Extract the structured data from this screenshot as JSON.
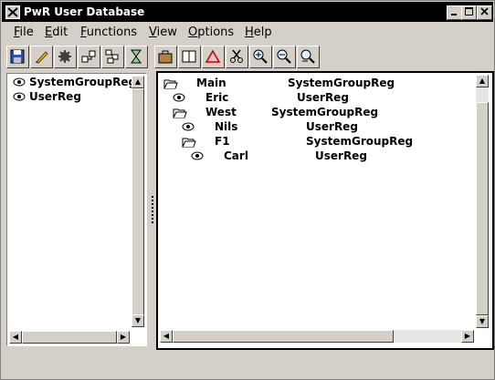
{
  "window": {
    "title": "PwR User Database"
  },
  "menubar": [
    {
      "first": "F",
      "rest": "ile"
    },
    {
      "first": "E",
      "rest": "dit"
    },
    {
      "first": "F",
      "rest": "unctions"
    },
    {
      "first": "V",
      "rest": "iew"
    },
    {
      "first": "O",
      "rest": "ptions"
    },
    {
      "first": "H",
      "rest": "elp"
    }
  ],
  "toolbar": [
    {
      "icon": "save-icon"
    },
    {
      "icon": "pencil-icon"
    },
    {
      "icon": "gear-icon"
    },
    {
      "icon": "hierarchy-icon"
    },
    {
      "icon": "tree-icon"
    },
    {
      "icon": "hourglass-icon"
    },
    {
      "icon": "briefcase-icon"
    },
    {
      "icon": "book-icon"
    },
    {
      "icon": "triangle-icon"
    },
    {
      "icon": "scissors-icon"
    },
    {
      "icon": "zoom-in-icon"
    },
    {
      "icon": "zoom-out-icon"
    },
    {
      "icon": "zoom-reset-icon"
    }
  ],
  "left_pane": {
    "items": [
      {
        "name": "SystemGroupReg",
        "icon": "eye-icon"
      },
      {
        "name": "UserReg",
        "icon": "eye-icon"
      }
    ]
  },
  "right_pane": {
    "rows": [
      {
        "name": "Main",
        "class": "SystemGroupReg",
        "icon": "folder-open-icon"
      },
      {
        "name": "Eric",
        "class": "UserReg",
        "icon": "eye-icon"
      },
      {
        "name": "West",
        "class": "SystemGroupReg",
        "icon": "folder-open-icon"
      },
      {
        "name": "Nils",
        "class": "UserReg",
        "icon": "eye-icon"
      },
      {
        "name": "F1",
        "class": "SystemGroupReg",
        "icon": "folder-open-icon"
      },
      {
        "name": "Carl",
        "class": "UserReg",
        "icon": "eye-icon"
      }
    ]
  }
}
